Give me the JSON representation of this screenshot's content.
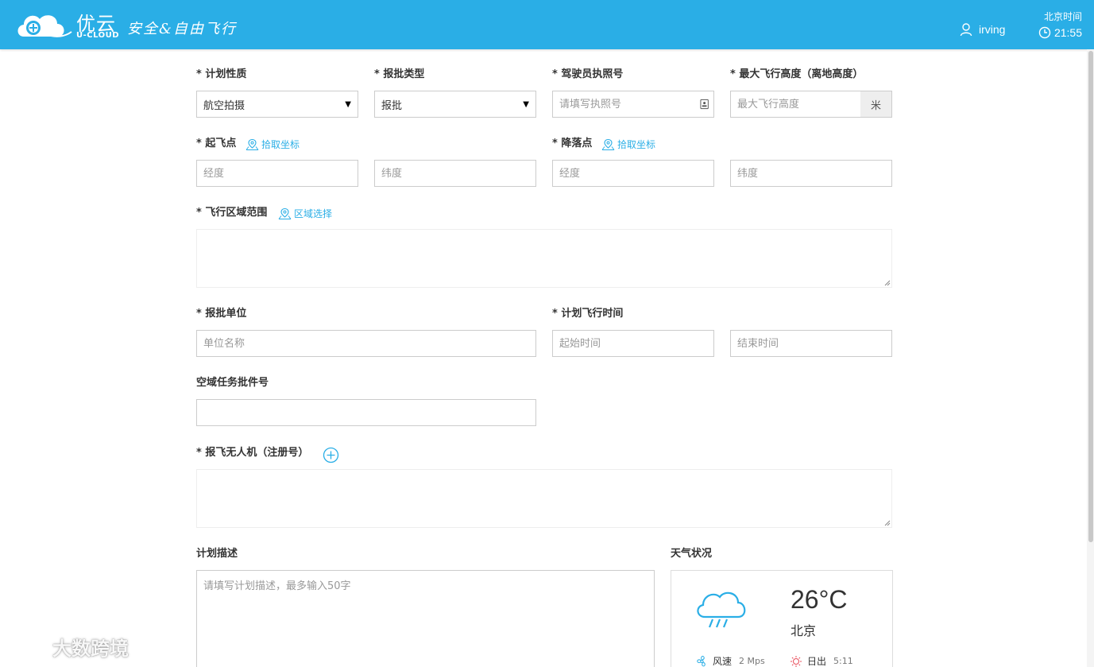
{
  "header": {
    "brand_cn": "优云",
    "brand_en": "U-CLOUD",
    "slogan": "安全&自由飞行",
    "username": "irving",
    "time_label": "北京时间",
    "time_value": "21:55"
  },
  "form": {
    "plan_type": {
      "label": "* 计划性质",
      "value": "航空拍摄"
    },
    "approval_type": {
      "label": "* 报批类型",
      "value": "报批"
    },
    "pilot_license": {
      "label": "* 驾驶员执照号",
      "placeholder": "请填写执照号"
    },
    "max_altitude": {
      "label": "* 最大飞行高度（离地高度）",
      "placeholder": "最大飞行高度",
      "unit": "米"
    },
    "takeoff": {
      "label": "* 起飞点",
      "pick_label": "拾取坐标",
      "lng_placeholder": "经度",
      "lat_placeholder": "纬度"
    },
    "landing": {
      "label": "* 降落点",
      "pick_label": "拾取坐标",
      "lng_placeholder": "经度",
      "lat_placeholder": "纬度"
    },
    "flight_area": {
      "label": "* 飞行区域范围",
      "select_label": "区域选择"
    },
    "approval_unit": {
      "label": "* 报批单位",
      "placeholder": "单位名称"
    },
    "plan_time": {
      "label": "* 计划飞行时间",
      "start_placeholder": "起始时间",
      "end_placeholder": "结束时间"
    },
    "airspace_permit": {
      "label": "空域任务批件号",
      "value": ""
    },
    "drones": {
      "label": "* 报飞无人机（注册号）"
    },
    "description": {
      "label": "计划描述",
      "placeholder": "请填写计划描述，最多输入50字"
    }
  },
  "weather": {
    "title": "天气状况",
    "temperature": "26°C",
    "city": "北京",
    "wind_label": "风速",
    "wind_value": "2 Mps",
    "sunrise_label": "日出",
    "sunrise_value": "5:11",
    "icon": "cloud-rain-lightning-icon"
  },
  "watermark": "大数跨境",
  "colors": {
    "header_bg": "#2aaee6",
    "link": "#2aaee6",
    "weather_icon": "#2aaee6",
    "sunrise_icon": "#e84c5a"
  }
}
